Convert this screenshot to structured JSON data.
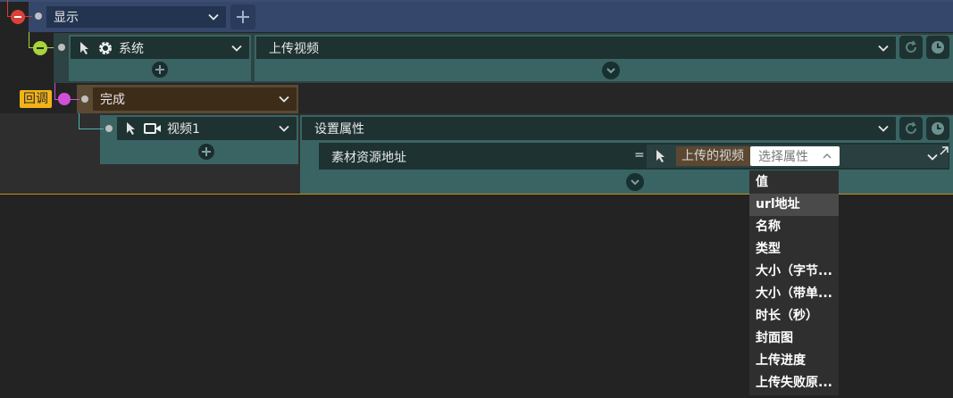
{
  "row1": {
    "dropdown_value": "显示"
  },
  "row2": {
    "target_value": "系统",
    "action_value": "上传视频"
  },
  "row3": {
    "callback_tag": "回调",
    "event_value": "完成"
  },
  "row4": {
    "target_value": "视频1",
    "action_value": "设置属性"
  },
  "property_row": {
    "label": "素材资源地址",
    "equals": "=",
    "source_value": "上传的视频",
    "select_placeholder": "选择属性"
  },
  "attribute_menu": [
    {
      "label": "值"
    },
    {
      "label": "url地址"
    },
    {
      "label": "名称"
    },
    {
      "label": "类型"
    },
    {
      "label": "大小（字节..."
    },
    {
      "label": "大小（带单..."
    },
    {
      "label": "时长（秒）"
    },
    {
      "label": "封面图"
    },
    {
      "label": "上传进度"
    },
    {
      "label": "上传失败原..."
    }
  ],
  "colors": {
    "accent_red": "#d9413a",
    "accent_lime": "#a8d43c",
    "accent_magenta": "#d050d6",
    "callback_orange": "#f2b318"
  }
}
